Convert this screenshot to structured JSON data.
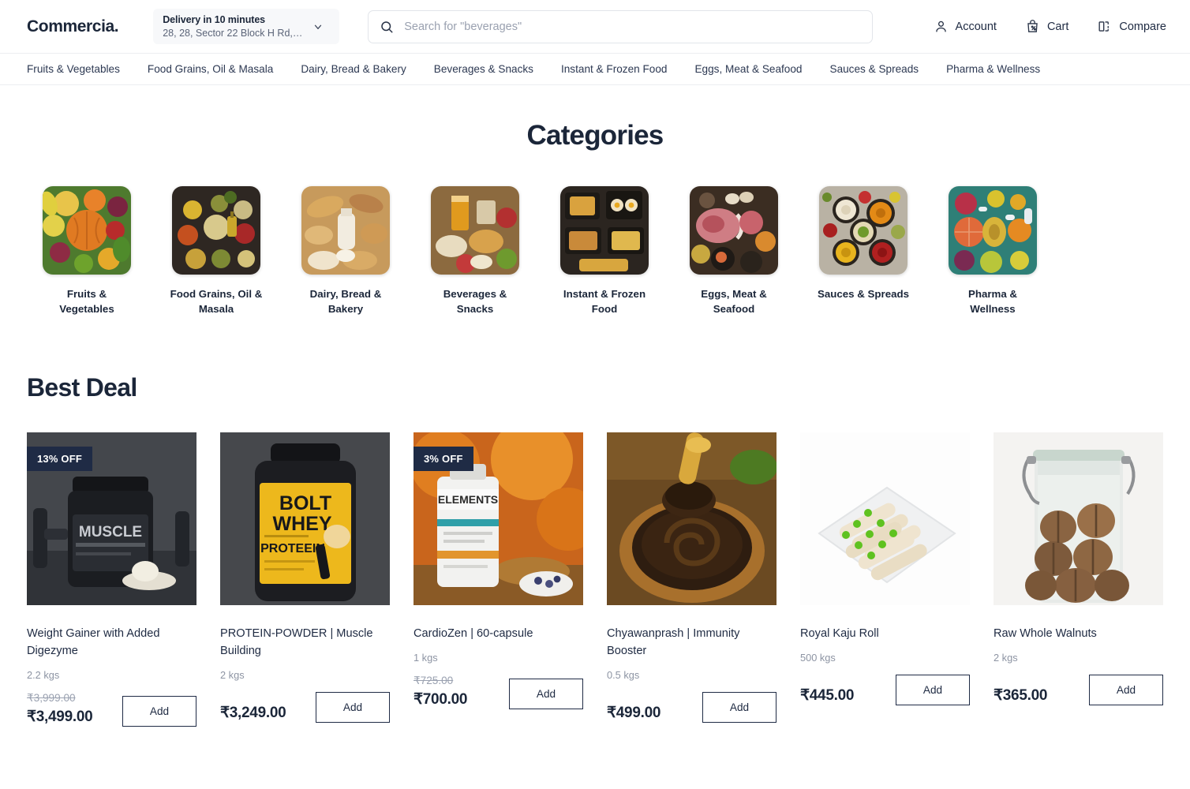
{
  "brand": {
    "logo": "Commercia."
  },
  "delivery": {
    "title": "Delivery in 10 minutes",
    "address": "28, 28, Sector 22 Block H Rd, H Bloc...",
    "chevron_icon": "chevron-down-icon"
  },
  "search": {
    "placeholder": "Search for \"beverages\"",
    "value": "",
    "icon": "search-icon"
  },
  "header_actions": [
    {
      "label": "Account",
      "icon": "user-icon"
    },
    {
      "label": "Cart",
      "icon": "shopping-bag-icon"
    },
    {
      "label": "Compare",
      "icon": "compare-icon"
    }
  ],
  "nav": {
    "items": [
      {
        "label": "Fruits & Vegetables"
      },
      {
        "label": "Food Grains, Oil & Masala"
      },
      {
        "label": "Dairy, Bread & Bakery"
      },
      {
        "label": "Beverages & Snacks"
      },
      {
        "label": "Instant & Frozen Food"
      },
      {
        "label": "Eggs, Meat & Seafood"
      },
      {
        "label": "Sauces & Spreads"
      },
      {
        "label": "Pharma & Wellness"
      }
    ]
  },
  "categories": {
    "heading": "Categories",
    "items": [
      {
        "label": "Fruits & Vegetables"
      },
      {
        "label": "Food Grains, Oil & Masala"
      },
      {
        "label": "Dairy, Bread & Bakery"
      },
      {
        "label": "Beverages & Snacks"
      },
      {
        "label": "Instant & Frozen Food"
      },
      {
        "label": "Eggs, Meat & Seafood"
      },
      {
        "label": "Sauces & Spreads"
      },
      {
        "label": "Pharma & Wellness"
      }
    ]
  },
  "best_deal": {
    "heading": "Best Deal",
    "add_label": "Add",
    "products": [
      {
        "name": "Weight Gainer with Added Digezyme",
        "qty": "2.2 kgs",
        "price_old": "₹3,999.00",
        "price": "₹3,499.00",
        "badge": "13% OFF",
        "add_label": "Add"
      },
      {
        "name": "PROTEIN-POWDER | Muscle Building",
        "qty": "2 kgs",
        "price_old": "",
        "price": "₹3,249.00",
        "badge": "",
        "add_label": "Add"
      },
      {
        "name": "CardioZen | 60-capsule",
        "qty": "1 kgs",
        "price_old": "₹725.00",
        "price": "₹700.00",
        "badge": "3% OFF",
        "add_label": "Add"
      },
      {
        "name": "Chyawanprash | Immunity Booster",
        "qty": "0.5 kgs",
        "price_old": "",
        "price": "₹499.00",
        "badge": "",
        "add_label": "Add"
      },
      {
        "name": "Royal Kaju Roll",
        "qty": "500 kgs",
        "price_old": "",
        "price": "₹445.00",
        "badge": "",
        "add_label": "Add"
      },
      {
        "name": "Raw Whole Walnuts",
        "qty": "2 kgs",
        "price_old": "",
        "price": "₹365.00",
        "badge": "",
        "add_label": "Add"
      }
    ]
  },
  "colors": {
    "ink": "#1b2639",
    "badge_bg": "#1f2b45",
    "muted": "#8d94a3",
    "border": "#e2e5ea"
  }
}
